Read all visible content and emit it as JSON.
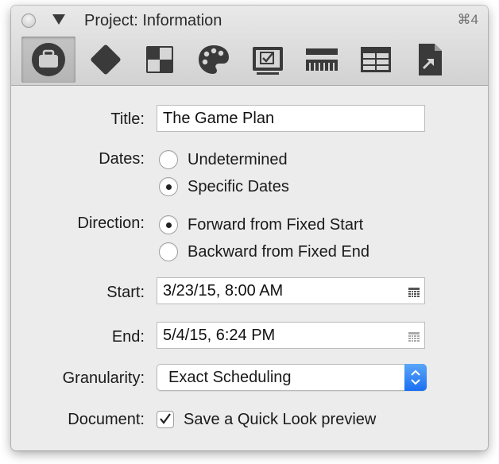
{
  "window": {
    "title": "Project: Information",
    "shortcut": "⌘4"
  },
  "toolbar": {
    "tools": [
      {
        "icon": "briefcase-icon",
        "selected": true
      },
      {
        "icon": "diamond-icon",
        "selected": false
      },
      {
        "icon": "checker-icon",
        "selected": false
      },
      {
        "icon": "palette-icon",
        "selected": false
      },
      {
        "icon": "checklist-icon",
        "selected": false
      },
      {
        "icon": "ruler-icon",
        "selected": false
      },
      {
        "icon": "table-icon",
        "selected": false
      },
      {
        "icon": "alias-document-icon",
        "selected": false
      }
    ]
  },
  "form": {
    "title_label": "Title:",
    "title_value": "The Game Plan",
    "dates_label": "Dates:",
    "dates_options": [
      {
        "label": "Undetermined",
        "selected": false
      },
      {
        "label": "Specific Dates",
        "selected": true
      }
    ],
    "direction_label": "Direction:",
    "direction_options": [
      {
        "label": "Forward from Fixed Start",
        "selected": true
      },
      {
        "label": "Backward from Fixed End",
        "selected": false
      }
    ],
    "start_label": "Start:",
    "start_value": "3/23/15, 8:00 AM",
    "end_label": "End:",
    "end_value": "5/4/15, 6:24 PM",
    "granularity_label": "Granularity:",
    "granularity_value": "Exact Scheduling",
    "document_label": "Document:",
    "quicklook_label": "Save a Quick Look preview",
    "quicklook_checked": true
  },
  "colors": {
    "accent": "#2f80f5",
    "window_bg": "#ececec"
  }
}
